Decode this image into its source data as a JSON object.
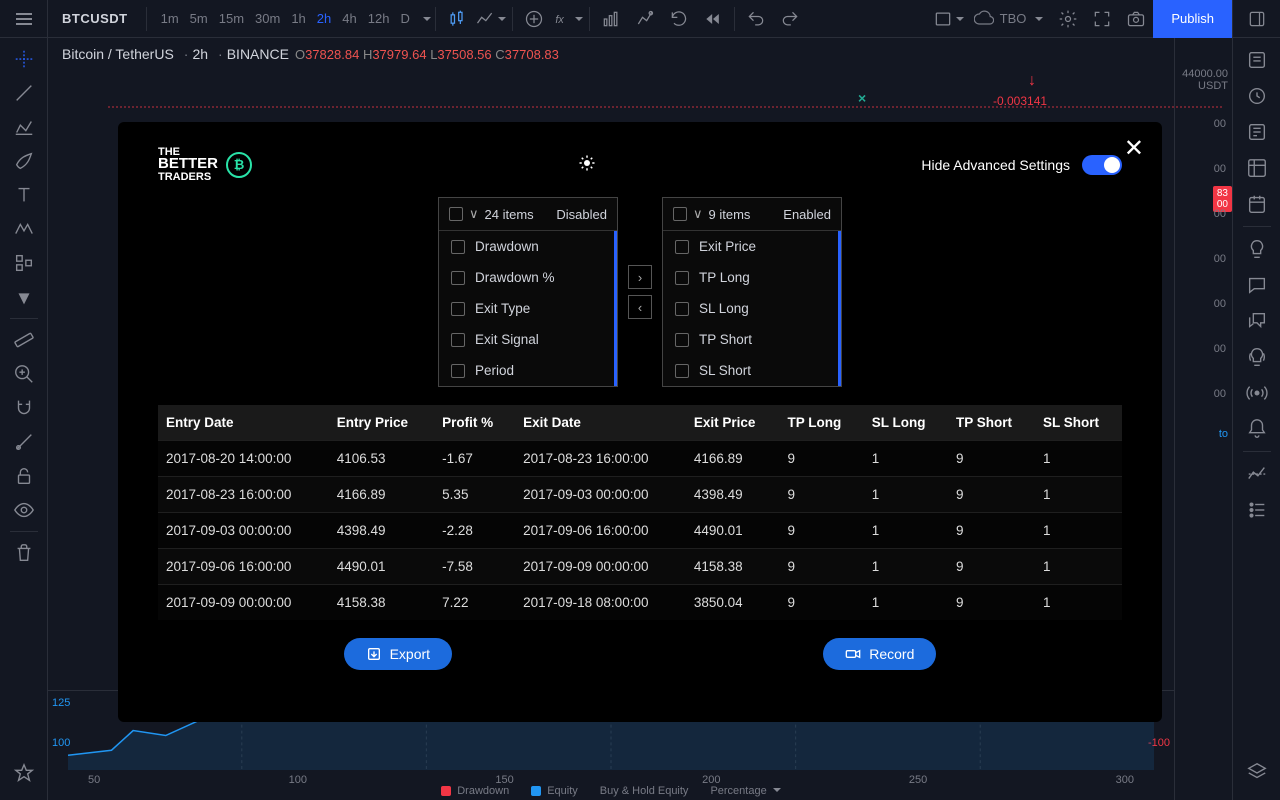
{
  "symbol": "BTCUSDT",
  "timeframes": [
    "1m",
    "5m",
    "15m",
    "30m",
    "1h",
    "2h",
    "4h",
    "12h",
    "D"
  ],
  "active_tf": "2h",
  "legend": {
    "pair": "Bitcoin / TetherUS",
    "tf": "2h",
    "exchange": "BINANCE",
    "O": "37828.84",
    "H": "37979.64",
    "L": "37508.56",
    "C": "37708.83"
  },
  "float": {
    "neg": "-0.003141"
  },
  "tbo_label": "TBO",
  "publish_label": "Publish",
  "price_axis": {
    "top_price": "44000.00",
    "currency": "USDT",
    "live_top": "83",
    "live_bot": "00",
    "ticks": [
      "00",
      "00",
      "00",
      "00",
      "00",
      "00",
      "00"
    ],
    "goto": "to"
  },
  "yleft": {
    "a": "125",
    "b": "100"
  },
  "yright": {
    "b": "-100"
  },
  "xaxis": [
    "50",
    "100",
    "150",
    "200",
    "250",
    "300"
  ],
  "bottom_legend": {
    "drawdown": "Drawdown",
    "equity": "Equity",
    "buyhold": "Buy & Hold Equity",
    "percentage": "Percentage"
  },
  "modal": {
    "brand1": "THE",
    "brand2": "BETTER",
    "brand3": "TRADERS",
    "adv_label": "Hide Advanced Settings",
    "left": {
      "count": "24 items",
      "state": "Disabled",
      "items": [
        "Drawdown",
        "Drawdown %",
        "Exit Type",
        "Exit Signal",
        "Period"
      ]
    },
    "right": {
      "count": "9 items",
      "state": "Enabled",
      "items": [
        "Exit Price",
        "TP Long",
        "SL Long",
        "TP Short",
        "SL Short"
      ]
    },
    "columns": [
      "Entry Date",
      "Entry Price",
      "Profit %",
      "Exit Date",
      "Exit Price",
      "TP Long",
      "SL Long",
      "TP Short",
      "SL Short"
    ],
    "rows": [
      [
        "2017-08-20 14:00:00",
        "4106.53",
        "-1.67",
        "2017-08-23 16:00:00",
        "4166.89",
        "9",
        "1",
        "9",
        "1"
      ],
      [
        "2017-08-23 16:00:00",
        "4166.89",
        "5.35",
        "2017-09-03 00:00:00",
        "4398.49",
        "9",
        "1",
        "9",
        "1"
      ],
      [
        "2017-09-03 00:00:00",
        "4398.49",
        "-2.28",
        "2017-09-06 16:00:00",
        "4490.01",
        "9",
        "1",
        "9",
        "1"
      ],
      [
        "2017-09-06 16:00:00",
        "4490.01",
        "-7.58",
        "2017-09-09 00:00:00",
        "4158.38",
        "9",
        "1",
        "9",
        "1"
      ],
      [
        "2017-09-09 00:00:00",
        "4158.38",
        "7.22",
        "2017-09-18 08:00:00",
        "3850.04",
        "9",
        "1",
        "9",
        "1"
      ]
    ],
    "export": "Export",
    "record": "Record"
  }
}
